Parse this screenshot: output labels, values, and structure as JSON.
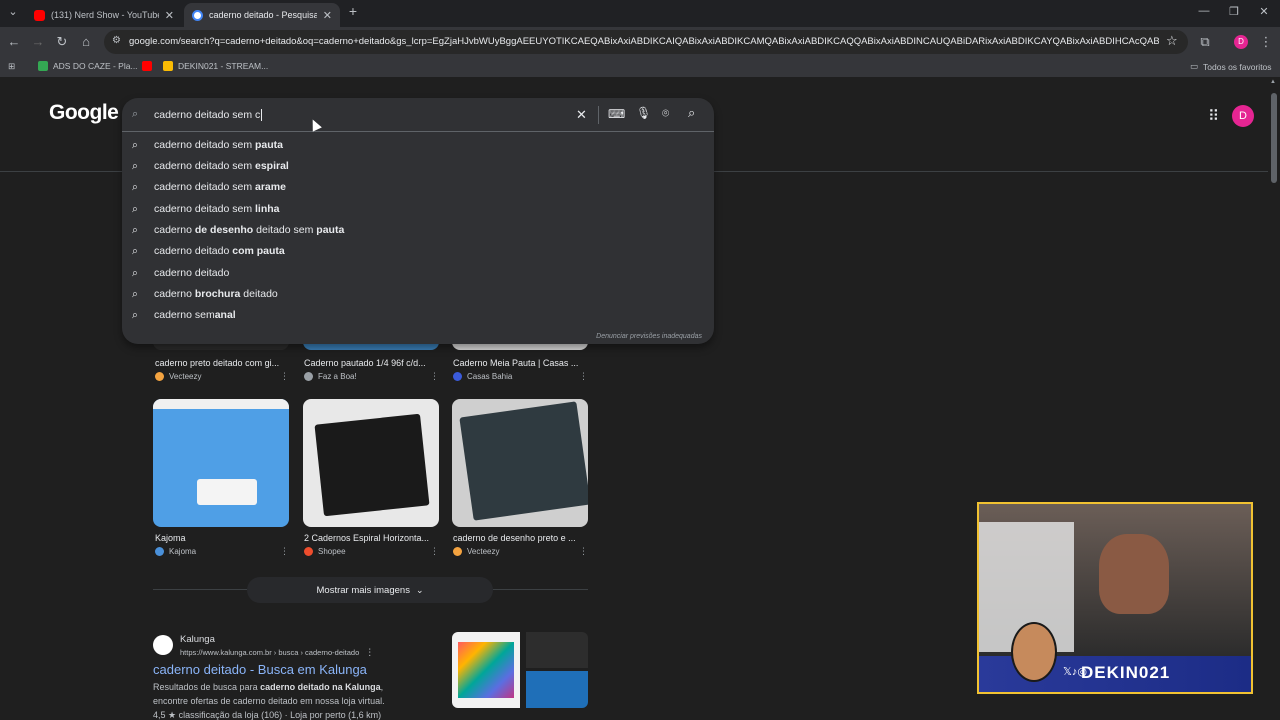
{
  "tabs": [
    {
      "title": "(131) Nerd Show - YouTube",
      "active": false,
      "favicon_color": "#ff0000"
    },
    {
      "title": "caderno deitado - Pesquisa Goo",
      "active": true,
      "favicon_color": "#ffffff"
    }
  ],
  "toolbar": {
    "url": "google.com/search?q=caderno+deitado&oq=caderno+deitado&gs_lcrp=EgZjaHJvbWUyBggAEEUYOTIKCAEQABixAxiABDIKCAIQABixAxiABDIKCAMQABixAxiABDIKCAQQABixAxiABDINCAUQABiDARixAxiABDIKCAYQABixAxiABDIHCAcQABiABDINCAgQA..."
  },
  "bookmarks": [
    {
      "label": "ADS DO CAZE - Pla...",
      "color": "#34a853"
    },
    {
      "label": "",
      "color": "#ff0000"
    },
    {
      "label": "DEKIN021 - STREAM...",
      "color": "#fbbc04"
    }
  ],
  "bookmarks_folder": "Todos os favoritos",
  "google": {
    "logo": "Google",
    "avatar_letter": "D",
    "avatar_color": "#e52592"
  },
  "search": {
    "query": "caderno deitado sem c",
    "suggestions": [
      {
        "plain": "caderno deitado sem ",
        "bold": "pauta",
        "tail": ""
      },
      {
        "plain": "caderno deitado sem ",
        "bold": "espiral",
        "tail": ""
      },
      {
        "plain": "caderno deitado sem ",
        "bold": "arame",
        "tail": ""
      },
      {
        "plain": "caderno deitado sem ",
        "bold": "linha",
        "tail": ""
      },
      {
        "plain": "caderno ",
        "bold": "de desenho",
        "tail": " deitado sem ",
        "bold2": "pauta"
      },
      {
        "plain": "caderno deitado ",
        "bold": "com pauta",
        "tail": ""
      },
      {
        "plain": "caderno deitado",
        "bold": "",
        "tail": ""
      },
      {
        "plain": "caderno ",
        "bold": "brochura",
        "tail": " deitado"
      },
      {
        "plain": "caderno sem",
        "bold": "anal",
        "tail": ""
      }
    ],
    "report": "Denunciar previsões inadequadas"
  },
  "images_row1": [
    {
      "caption": "caderno preto deitado com gi...",
      "source": "Vecteezy",
      "source_color": "#f4a340"
    },
    {
      "caption": "Caderno pautado 1/4 96f c/d...",
      "source": "Faz a Boa!",
      "source_color": "#9aa0a6"
    },
    {
      "caption": "Caderno Meia Pauta | Casas ...",
      "source": "Casas Bahia",
      "source_color": "#3b5bdb"
    }
  ],
  "images_row2": [
    {
      "caption": "Kajoma",
      "source": "Kajoma",
      "source_color": "#4a90d9",
      "brand": "kajoma"
    },
    {
      "caption": "2 Cadernos Espiral Horizonta...",
      "source": "Shopee",
      "source_color": "#ee4d2d"
    },
    {
      "caption": "caderno de desenho preto e ...",
      "source": "Vecteezy",
      "source_color": "#f4a340"
    }
  ],
  "show_more": "Mostrar mais imagens",
  "result": {
    "site": "Kalunga",
    "url": "https://www.kalunga.com.br › busca › caderno-deitado",
    "title": "caderno deitado - Busca em Kalunga",
    "snippet1_pre": "Resultados de busca para ",
    "snippet1_bold": "caderno deitado na Kalunga",
    "snippet1_post": ",",
    "snippet2": "encontre ofertas de caderno deitado em nossa loja virtual.",
    "snippet3": "4,5 ★ classificação da loja (106) · Loja por perto (1,6 km)"
  },
  "webcam": {
    "handle": "DEKIN021"
  }
}
